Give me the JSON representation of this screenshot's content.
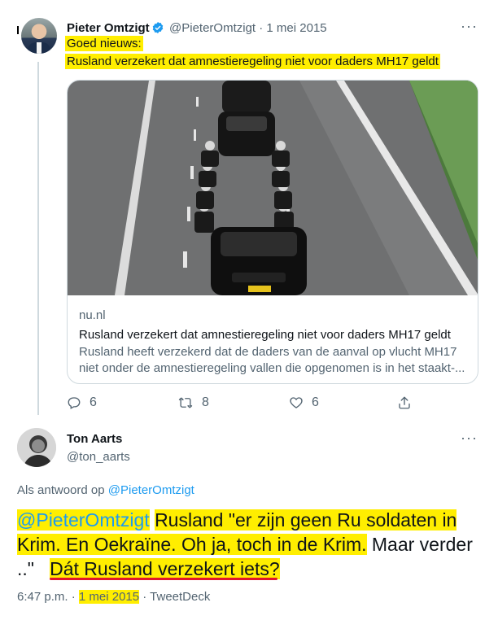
{
  "tweet1": {
    "author_name": "Pieter Omtzigt",
    "handle_date": "@PieterOmtzigt · 1 mei 2015",
    "more": "···",
    "line1": "Goed nieuws:",
    "line2": "Rusland verzekert dat amnestieregeling niet voor daders MH17 geldt",
    "card": {
      "domain": "nu.nl",
      "title": "Rusland verzekert dat amnestieregeling niet voor daders MH17 geldt",
      "description": "Rusland heeft verzekerd dat de daders van de aanval op vlucht MH17 niet onder de amnestieregeling vallen die opgenomen is in het staakt-..."
    },
    "actions": {
      "replies": "6",
      "retweets": "8",
      "likes": "6"
    }
  },
  "tweet2": {
    "author_name": "Ton Aarts",
    "handle": "@ton_aarts",
    "more": "···",
    "reply_prefix": "Als antwoord op",
    "reply_to": "@PieterOmtzigt",
    "mention": "@PieterOmtzigt",
    "l1": "Rusland \"er zijn geen Ru soldaten in",
    "l2a": "Krim. En Oekraïne. Oh ja, toch in de Krim.",
    "l2b": " Maar verder",
    "l3a": "..\"",
    "l3b": "Dát Rusland verzekert iets?",
    "time": "6:47 p.m. ·",
    "date": "1 mei 2015",
    "source": "· TweetDeck"
  },
  "colors": {
    "highlight": "#ffee00",
    "link": "#1d9bf0",
    "underline": "#e0162b",
    "verified": "#1d9bf0"
  }
}
